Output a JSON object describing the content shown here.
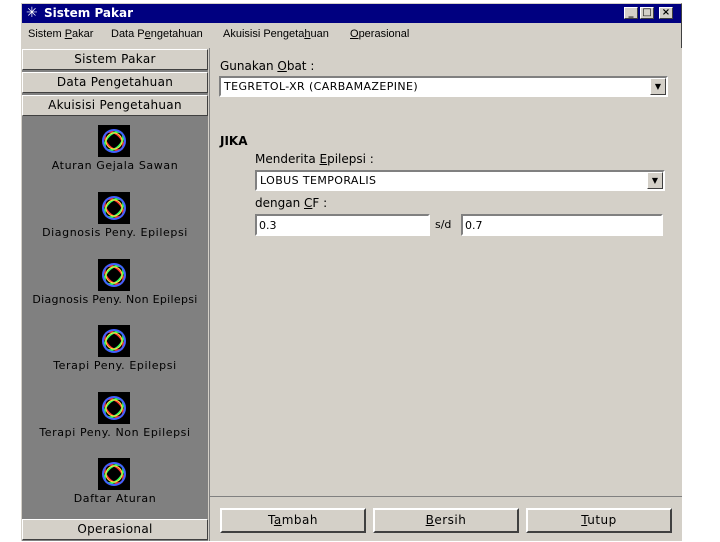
{
  "window": {
    "title": "Sistem Pakar"
  },
  "menu": [
    {
      "pre": "Sistem ",
      "key": "P",
      "post": "akar"
    },
    {
      "pre": "Data P",
      "key": "e",
      "post": "ngetahuan"
    },
    {
      "pre": "Akuisisi Pengeta",
      "key": "h",
      "post": "uan"
    },
    {
      "pre": "",
      "key": "O",
      "post": "perasional"
    }
  ],
  "sidebar": {
    "headers": [
      "Sistem Pakar",
      "Data Pengetahuan",
      "Akuisisi Pengetahuan"
    ],
    "footer_header": "Operasional",
    "items": [
      {
        "label": "Aturan Gejala Sawan",
        "icon": "ring-icon"
      },
      {
        "label": "Diagnosis Peny. Epilepsi",
        "icon": "ring-icon"
      },
      {
        "label": "Diagnosis Peny. Non Epilepsi",
        "icon": "ring-icon"
      },
      {
        "label": "Terapi Peny. Epilepsi",
        "icon": "ring-icon"
      },
      {
        "label": "Terapi Peny. Non Epilepsi",
        "icon": "ring-icon"
      },
      {
        "label": "Daftar Aturan",
        "icon": "ring-icon"
      }
    ]
  },
  "form": {
    "obat_label": {
      "pre": "Gunakan ",
      "key": "O",
      "post": "bat :"
    },
    "obat_value": "TEGRETOL-XR (CARBAMAZEPINE)",
    "jika_label": "JIKA",
    "epilepsi_label": {
      "pre": "Menderita ",
      "key": "E",
      "post": "pilepsi :"
    },
    "epilepsi_value": "LOBUS TEMPORALIS",
    "cf_label": {
      "pre": "dengan ",
      "key": "C",
      "post": "F :"
    },
    "cf_min": "0.3",
    "sd_label": "s/d",
    "cf_max": "0.7"
  },
  "buttons": [
    {
      "pre": "T",
      "key": "a",
      "post": "mbah"
    },
    {
      "pre": "",
      "key": "B",
      "post": "ersih"
    },
    {
      "pre": "",
      "key": "T",
      "post": "utup"
    }
  ]
}
